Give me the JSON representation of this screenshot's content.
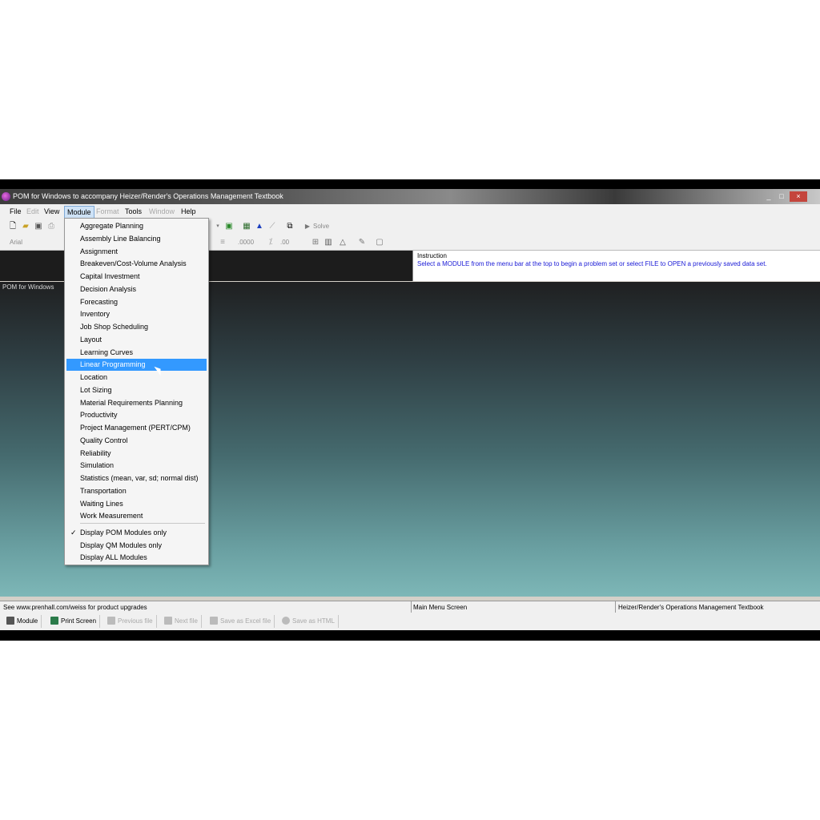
{
  "window": {
    "title": "POM for Windows to accompany Heizer/Render's Operations Management Textbook",
    "controls": [
      "_",
      "□",
      "×"
    ]
  },
  "menubar": {
    "items": [
      {
        "label": "File",
        "enabled": true
      },
      {
        "label": "Edit",
        "enabled": false
      },
      {
        "label": "View",
        "enabled": true
      },
      {
        "label": "Module",
        "enabled": true
      },
      {
        "label": "Format",
        "enabled": false
      },
      {
        "label": "Tools",
        "enabled": true
      },
      {
        "label": "Window",
        "enabled": false
      },
      {
        "label": "Help",
        "enabled": true
      }
    ]
  },
  "toolbar": {
    "solve_label": "Solve",
    "font_name": "Arial",
    "number_format": ".0000",
    "decimal_label": ".00"
  },
  "instruction": {
    "label": "Instruction",
    "text": "Select a MODULE from the menu bar at the top to begin a problem set or select FILE to OPEN a previously saved data set."
  },
  "workspace": {
    "label": "POM for Windows"
  },
  "module_menu": {
    "items": [
      "Aggregate Planning",
      "Assembly Line Balancing",
      "Assignment",
      "Breakeven/Cost-Volume Analysis",
      "Capital Investment",
      "Decision Analysis",
      "Forecasting",
      "Inventory",
      "Job Shop Scheduling",
      "Layout",
      "Learning Curves",
      "Linear Programming",
      "Location",
      "Lot Sizing",
      "Material Requirements Planning",
      "Productivity",
      "Project Management (PERT/CPM)",
      "Quality Control",
      "Reliability",
      "Simulation",
      "Statistics (mean, var, sd; normal dist)",
      "Transportation",
      "Waiting Lines",
      "Work Measurement"
    ],
    "highlighted": "Linear Programming",
    "display_options": [
      {
        "label": "Display POM Modules only",
        "checked": true
      },
      {
        "label": "Display QM Modules only",
        "checked": false
      },
      {
        "label": "Display ALL Modules",
        "checked": false
      }
    ],
    "check_mark": "✓"
  },
  "statusbar": {
    "left": "See www.prenhall.com/weiss for product upgrades",
    "middle": "Main Menu Screen",
    "right": "Heizer/Render's Operations Management Textbook"
  },
  "bottombar": {
    "buttons": [
      {
        "label": "Module",
        "enabled": true
      },
      {
        "label": "Print Screen",
        "enabled": true
      },
      {
        "label": "Previous file",
        "enabled": false
      },
      {
        "label": "Next file",
        "enabled": false
      },
      {
        "label": "Save as Excel file",
        "enabled": false
      },
      {
        "label": "Save as HTML",
        "enabled": false
      }
    ]
  },
  "colors": {
    "highlight": "#3399ff",
    "instruction_text": "#1a1ad6",
    "workspace_top": "#1f2021",
    "workspace_bottom": "#7db7b7"
  }
}
